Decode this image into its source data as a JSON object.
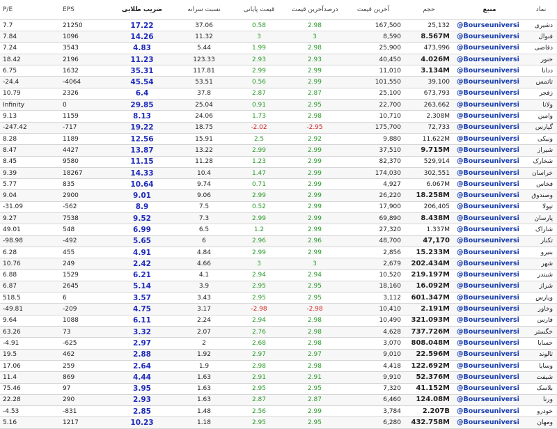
{
  "headers": {
    "pe": "P/E",
    "eps": "EPS",
    "tb": "ضریب طلایی",
    "ns": "نسبت سرانه",
    "qp": "قیمت پایانی",
    "dq": "درصدآخرین قیمت",
    "aq": "آخرین قیمت",
    "hj": "حجم",
    "src": "منبع",
    "sym": "نماد"
  },
  "rows": [
    {
      "pe": "7.7",
      "eps": "21250",
      "tb": "17.22",
      "ns": "37.06",
      "qp": "0.58",
      "dq": "2.98",
      "aq": "167,500",
      "hj": "25,132",
      "big": false,
      "src": "@Bourseuniversi",
      "sym": "دشیری"
    },
    {
      "pe": "7.84",
      "eps": "1096",
      "tb": "14.26",
      "ns": "11.32",
      "qp": "3",
      "dq": "3",
      "aq": "8,590",
      "hj": "8.567M",
      "big": true,
      "src": "@Bourseuniversi",
      "sym": "فنوال"
    },
    {
      "pe": "7.24",
      "eps": "3543",
      "tb": "4.83",
      "ns": "5.44",
      "qp": "1.99",
      "dq": "2.98",
      "aq": "25,900",
      "hj": "473,996",
      "big": false,
      "src": "@Bourseuniversi",
      "sym": "دقاضی"
    },
    {
      "pe": "18.42",
      "eps": "2196",
      "tb": "11.23",
      "ns": "123.33",
      "qp": "2.93",
      "dq": "2.93",
      "aq": "40,450",
      "hj": "4.026M",
      "big": true,
      "src": "@Bourseuniversi",
      "sym": "خنور"
    },
    {
      "pe": "6.75",
      "eps": "1632",
      "tb": "35.31",
      "ns": "117.81",
      "qp": "2.99",
      "dq": "2.99",
      "aq": "11,010",
      "hj": "3.134M",
      "big": true,
      "src": "@Bourseuniversi",
      "sym": "ددانا"
    },
    {
      "pe": "-24.4",
      "eps": "-4064",
      "tb": "45.54",
      "ns": "53.51",
      "qp": "0.56",
      "dq": "2.99",
      "aq": "101,550",
      "hj": "39,100",
      "big": false,
      "src": "@Bourseuniversi",
      "sym": "تاتمس"
    },
    {
      "pe": "10.79",
      "eps": "2326",
      "tb": "6.4",
      "ns": "37.8",
      "qp": "2.87",
      "dq": "2.87",
      "aq": "25,100",
      "hj": "673,793",
      "big": false,
      "src": "@Bourseuniversi",
      "sym": "زفجر"
    },
    {
      "pe": "Infinity",
      "eps": "0",
      "tb": "29.85",
      "ns": "25.04",
      "qp": "0.91",
      "dq": "2.95",
      "aq": "22,700",
      "hj": "263,662",
      "big": false,
      "src": "@Bourseuniversi",
      "sym": "ولانا"
    },
    {
      "pe": "9.13",
      "eps": "1159",
      "tb": "8.13",
      "ns": "24.06",
      "qp": "1.73",
      "dq": "2.98",
      "aq": "10,710",
      "hj": "2.308M",
      "big": false,
      "src": "@Bourseuniversi",
      "sym": "وامین"
    },
    {
      "pe": "-247.42",
      "eps": "-717",
      "tb": "19.22",
      "ns": "18.75",
      "qp": "-2.02",
      "dq": "-2.95",
      "aq": "175,700",
      "hj": "72,733",
      "big": false,
      "src": "@Bourseuniversi",
      "sym": "گپارس"
    },
    {
      "pe": "8.28",
      "eps": "1189",
      "tb": "12.56",
      "ns": "15.91",
      "qp": "2.5",
      "dq": "2.92",
      "aq": "9,880",
      "hj": "11.622M",
      "big": false,
      "src": "@Bourseuniversi",
      "sym": "ونیکی"
    },
    {
      "pe": "8.47",
      "eps": "4427",
      "tb": "13.87",
      "ns": "13.22",
      "qp": "2.99",
      "dq": "2.99",
      "aq": "37,510",
      "hj": "9.715M",
      "big": true,
      "src": "@Bourseuniversi",
      "sym": "شیراز"
    },
    {
      "pe": "8.45",
      "eps": "9580",
      "tb": "11.15",
      "ns": "11.28",
      "qp": "1.23",
      "dq": "2.99",
      "aq": "82,370",
      "hj": "529,914",
      "big": false,
      "src": "@Bourseuniversi",
      "sym": "شخارک"
    },
    {
      "pe": "9.39",
      "eps": "18267",
      "tb": "14.33",
      "ns": "10.4",
      "qp": "1.47",
      "dq": "2.99",
      "aq": "174,030",
      "hj": "302,551",
      "big": false,
      "src": "@Bourseuniversi",
      "sym": "خراسان"
    },
    {
      "pe": "5.77",
      "eps": "835",
      "tb": "10.64",
      "ns": "9.74",
      "qp": "0.71",
      "dq": "2.99",
      "aq": "4,927",
      "hj": "6.067M",
      "big": false,
      "src": "@Bourseuniversi",
      "sym": "فخاس"
    },
    {
      "pe": "9.04",
      "eps": "2900",
      "tb": "9.01",
      "ns": "9.06",
      "qp": "2.99",
      "dq": "2.99",
      "aq": "26,220",
      "hj": "18.258M",
      "big": true,
      "src": "@Bourseuniversi",
      "sym": "وصندوق"
    },
    {
      "pe": "-31.09",
      "eps": "-562",
      "tb": "8.9",
      "ns": "7.5",
      "qp": "0.52",
      "dq": "2.99",
      "aq": "17,900",
      "hj": "206,405",
      "big": false,
      "src": "@Bourseuniversi",
      "sym": "تپولا"
    },
    {
      "pe": "9.27",
      "eps": "7538",
      "tb": "9.52",
      "ns": "7.3",
      "qp": "2.99",
      "dq": "2.99",
      "aq": "69,890",
      "hj": "8.438M",
      "big": true,
      "src": "@Bourseuniversi",
      "sym": "پارسان"
    },
    {
      "pe": "49.01",
      "eps": "548",
      "tb": "6.99",
      "ns": "6.5",
      "qp": "1.2",
      "dq": "2.99",
      "aq": "27,320",
      "hj": "1.337M",
      "big": false,
      "src": "@Bourseuniversi",
      "sym": "شاراک"
    },
    {
      "pe": "-98.98",
      "eps": "-492",
      "tb": "5.65",
      "ns": "6",
      "qp": "2.96",
      "dq": "2.96",
      "aq": "48,700",
      "hj": "47,170",
      "big": true,
      "src": "@Bourseuniversi",
      "sym": "تکنار"
    },
    {
      "pe": "6.28",
      "eps": "455",
      "tb": "4.91",
      "ns": "4.84",
      "qp": "2.99",
      "dq": "2.99",
      "aq": "2,856",
      "hj": "15.233M",
      "big": true,
      "src": "@Bourseuniversi",
      "sym": "بنیرو"
    },
    {
      "pe": "10.76",
      "eps": "249",
      "tb": "2.42",
      "ns": "4.66",
      "qp": "3",
      "dq": "3",
      "aq": "2,679",
      "hj": "202.434M",
      "big": true,
      "src": "@Bourseuniversi",
      "sym": "شهر"
    },
    {
      "pe": "6.88",
      "eps": "1529",
      "tb": "6.21",
      "ns": "4.1",
      "qp": "2.94",
      "dq": "2.94",
      "aq": "10,520",
      "hj": "219.197M",
      "big": true,
      "src": "@Bourseuniversi",
      "sym": "شبندر"
    },
    {
      "pe": "6.87",
      "eps": "2645",
      "tb": "5.14",
      "ns": "3.9",
      "qp": "2.95",
      "dq": "2.95",
      "aq": "18,160",
      "hj": "16.092M",
      "big": true,
      "src": "@Bourseuniversi",
      "sym": "شراز"
    },
    {
      "pe": "518.5",
      "eps": "6",
      "tb": "3.57",
      "ns": "3.43",
      "qp": "2.95",
      "dq": "2.95",
      "aq": "3,112",
      "hj": "601.347M",
      "big": true,
      "src": "@Bourseuniversi",
      "sym": "وپارس"
    },
    {
      "pe": "-49.81",
      "eps": "-209",
      "tb": "4.75",
      "ns": "3.17",
      "qp": "-2.98",
      "dq": "-2.98",
      "aq": "10,410",
      "hj": "2.191M",
      "big": true,
      "src": "@Bourseuniversi",
      "sym": "وخاور"
    },
    {
      "pe": "9.64",
      "eps": "1088",
      "tb": "6.11",
      "ns": "2.24",
      "qp": "2.94",
      "dq": "2.98",
      "aq": "10,490",
      "hj": "321.093M",
      "big": true,
      "src": "@Bourseuniversi",
      "sym": "فارس"
    },
    {
      "pe": "63.26",
      "eps": "73",
      "tb": "3.32",
      "ns": "2.07",
      "qp": "2.76",
      "dq": "2.98",
      "aq": "4,628",
      "hj": "737.726M",
      "big": true,
      "src": "@Bourseuniversi",
      "sym": "خگستر"
    },
    {
      "pe": "-4.91",
      "eps": "-625",
      "tb": "2.97",
      "ns": "2",
      "qp": "2.68",
      "dq": "2.98",
      "aq": "3,070",
      "hj": "808.048M",
      "big": true,
      "src": "@Bourseuniversi",
      "sym": "حسابا"
    },
    {
      "pe": "19.5",
      "eps": "462",
      "tb": "2.88",
      "ns": "1.92",
      "qp": "2.97",
      "dq": "2.97",
      "aq": "9,010",
      "hj": "22.596M",
      "big": true,
      "src": "@Bourseuniversi",
      "sym": "تالوند"
    },
    {
      "pe": "17.06",
      "eps": "259",
      "tb": "2.64",
      "ns": "1.9",
      "qp": "2.98",
      "dq": "2.98",
      "aq": "4,418",
      "hj": "122.692M",
      "big": true,
      "src": "@Bourseuniversi",
      "sym": "وسایا"
    },
    {
      "pe": "11.4",
      "eps": "869",
      "tb": "4.44",
      "ns": "1.63",
      "qp": "2.91",
      "dq": "2.91",
      "aq": "9,910",
      "hj": "52.376M",
      "big": true,
      "src": "@Bourseuniversi",
      "sym": "شیفت"
    },
    {
      "pe": "75.46",
      "eps": "97",
      "tb": "3.95",
      "ns": "1.63",
      "qp": "2.95",
      "dq": "2.95",
      "aq": "7,320",
      "hj": "41.152M",
      "big": true,
      "src": "@Bourseuniversi",
      "sym": "بلاسک"
    },
    {
      "pe": "22.28",
      "eps": "290",
      "tb": "2.93",
      "ns": "1.63",
      "qp": "2.87",
      "dq": "2.87",
      "aq": "6,460",
      "hj": "124.08M",
      "big": true,
      "src": "@Bourseuniversi",
      "sym": "ورنا"
    },
    {
      "pe": "-4.53",
      "eps": "-831",
      "tb": "2.85",
      "ns": "1.48",
      "qp": "2.56",
      "dq": "2.99",
      "aq": "3,784",
      "hj": "2.207B",
      "big": true,
      "src": "@Bourseuniversi",
      "sym": "خودرو"
    },
    {
      "pe": "5.16",
      "eps": "1217",
      "tb": "10.23",
      "ns": "1.18",
      "qp": "2.95",
      "dq": "2.95",
      "aq": "6,280",
      "hj": "432.758M",
      "big": true,
      "src": "@Bourseuniversi",
      "sym": "ومهان"
    }
  ]
}
